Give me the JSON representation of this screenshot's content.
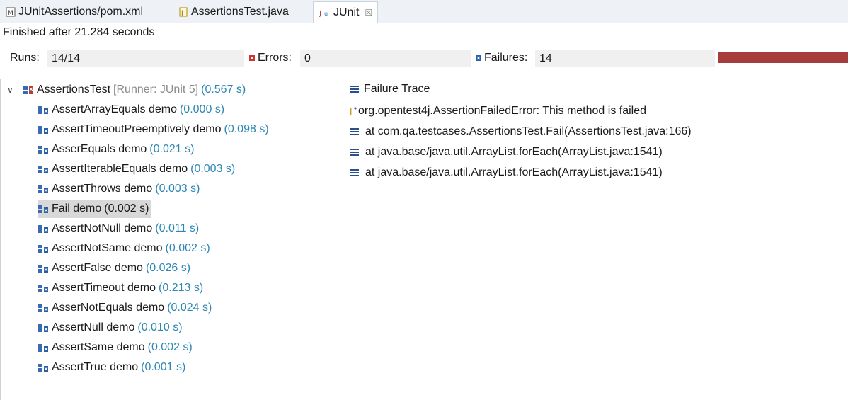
{
  "tabs": [
    {
      "label": "JUnitAssertions/pom.xml",
      "icon": "maven-pom-icon"
    },
    {
      "label": "AssertionsTest.java",
      "icon": "java-file-icon"
    },
    {
      "label": "JUnit",
      "icon": "junit-icon",
      "close": "☒"
    }
  ],
  "status": "Finished after 21.284 seconds",
  "counters": {
    "runs_label": "Runs:",
    "runs_value": "14/14",
    "errors_label": "Errors:",
    "errors_value": "0",
    "failures_label": "Failures:",
    "failures_value": "14",
    "progress_fraction": 1.0,
    "progress_color": "#a83c3c"
  },
  "tree": {
    "root": {
      "name": "AssertionsTest",
      "runner": "[Runner: JUnit 5]",
      "time": "(0.567 s)"
    },
    "items": [
      {
        "name": "AssertArrayEquals demo",
        "time": "(0.000 s)"
      },
      {
        "name": "AssertTimeoutPreemptively demo",
        "time": "(0.098 s)"
      },
      {
        "name": "AsserEquals demo",
        "time": "(0.021 s)"
      },
      {
        "name": "AssertIterableEquals demo",
        "time": "(0.003 s)"
      },
      {
        "name": "AssertThrows demo",
        "time": "(0.003 s)"
      },
      {
        "name": "Fail demo",
        "time": "(0.002 s)",
        "selected": true
      },
      {
        "name": "AssertNotNull demo",
        "time": "(0.011 s)"
      },
      {
        "name": "AssertNotSame demo",
        "time": "(0.002 s)"
      },
      {
        "name": "AssertFalse demo",
        "time": "(0.026 s)"
      },
      {
        "name": "AssertTimeout demo",
        "time": "(0.213 s)"
      },
      {
        "name": "AsserNotEquals demo",
        "time": "(0.024 s)"
      },
      {
        "name": "AssertNull demo",
        "time": "(0.010 s)"
      },
      {
        "name": "AssertSame demo",
        "time": "(0.002 s)"
      },
      {
        "name": "AssertTrue demo",
        "time": "(0.001 s)"
      }
    ]
  },
  "trace": {
    "header": "Failure Trace",
    "lines": [
      {
        "text": "org.opentest4j.AssertionFailedError: This method is failed",
        "icon": "exception-icon"
      },
      {
        "text": "at com.qa.testcases.AssertionsTest.Fail(AssertionsTest.java:166)",
        "icon": "stack-frame-icon"
      },
      {
        "text": "at java.base/java.util.ArrayList.forEach(ArrayList.java:1541)",
        "icon": "stack-frame-icon"
      },
      {
        "text": "at java.base/java.util.ArrayList.forEach(ArrayList.java:1541)",
        "icon": "stack-frame-icon"
      }
    ]
  },
  "colors": {
    "accent_time": "#2e87b3",
    "failure_bar": "#a83c3c",
    "selection": "#d8d8d8"
  }
}
